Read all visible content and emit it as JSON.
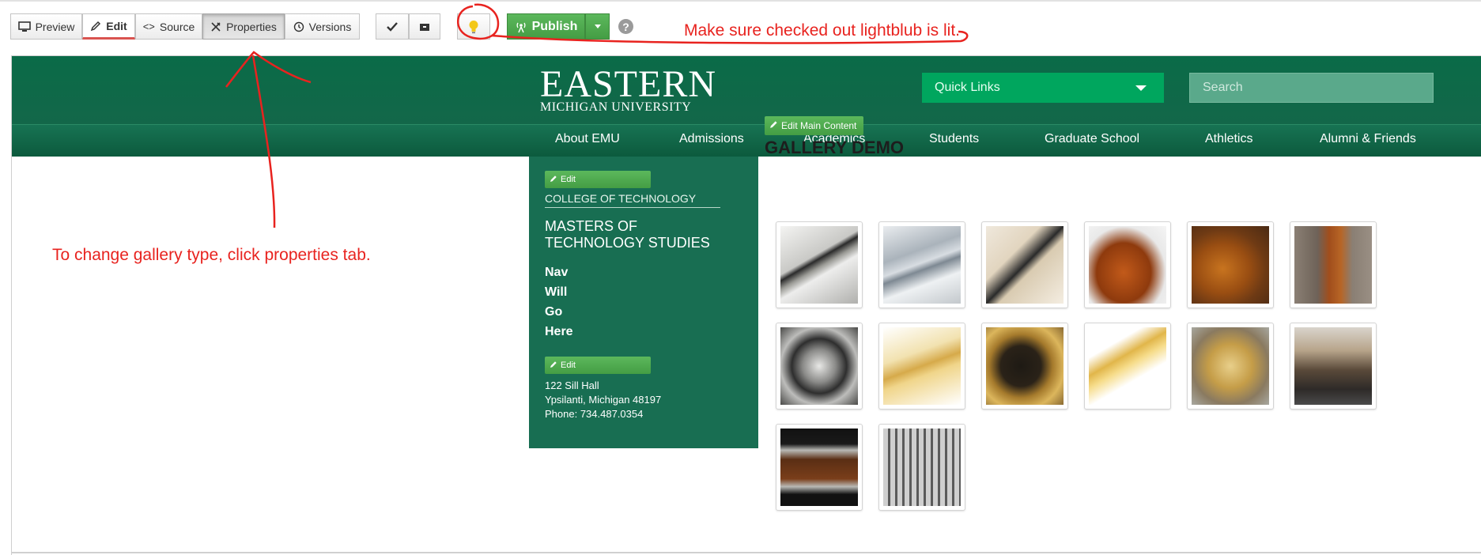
{
  "toolbar": {
    "preview_label": "Preview",
    "edit_label": "Edit",
    "source_label": "Source",
    "properties_label": "Properties",
    "versions_label": "Versions",
    "publish_label": "Publish",
    "help_label": "?"
  },
  "header": {
    "logo_main": "EASTERN",
    "logo_sub": "MICHIGAN UNIVERSITY",
    "quick_links": "Quick Links",
    "search_placeholder": "Search",
    "nav": [
      "About EMU",
      "Admissions",
      "Academics",
      "Students",
      "Graduate School",
      "Athletics",
      "Alumni & Friends"
    ]
  },
  "sidebar": {
    "edit_label": "Edit",
    "college": "COLLEGE OF TECHNOLOGY",
    "program_line1": "MASTERS OF",
    "program_line2": "TECHNOLOGY STUDIES",
    "nav": [
      "Nav",
      "Will",
      "Go",
      "Here"
    ],
    "edit2_label": "Edit",
    "address": [
      "122 Sill Hall",
      "Ypsilanti, Michigan 48197",
      "Phone: 734.487.0354"
    ]
  },
  "main": {
    "edit_main_label": "Edit Main Content",
    "title": "GALLERY DEMO",
    "thumbnails": [
      "clarinet-icon",
      "flute-icon",
      "oboe-icon",
      "violin-icon",
      "cello-icon",
      "double-bass-icon",
      "sousaphone-valves-icon",
      "trumpet-icon",
      "saxophone-icon",
      "trombone-icon",
      "euphonium-icon",
      "timpani-icon",
      "snare-drum-icon",
      "xylophone-icon"
    ]
  },
  "annotations": {
    "lightbulb_note": "Make sure checked out lightblub is lit.",
    "properties_note": "To change gallery type, click properties tab."
  },
  "colors": {
    "emu_green": "#0a6b48",
    "quick_links_green": "#00a65e",
    "publish_green": "#5cb85c",
    "annotation_red": "#e8231f"
  }
}
